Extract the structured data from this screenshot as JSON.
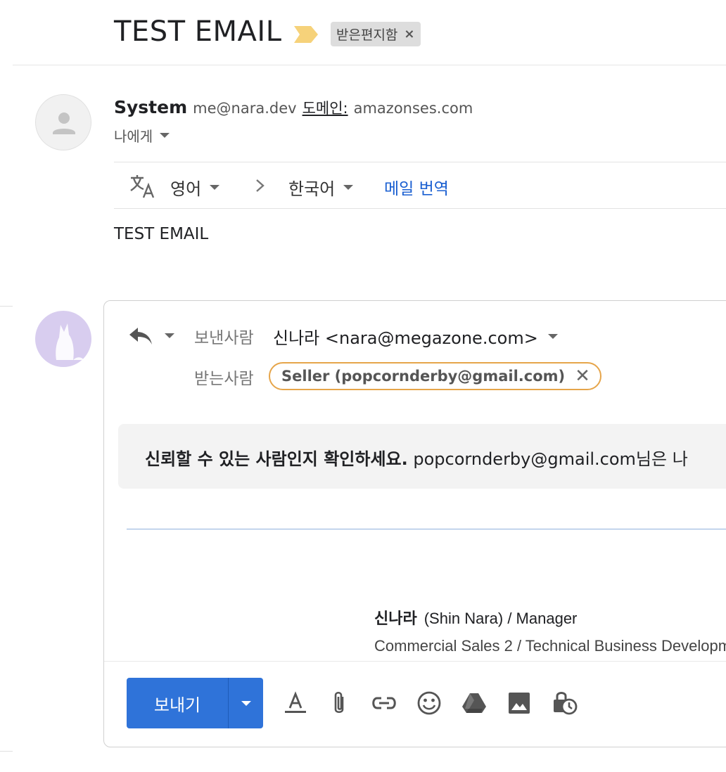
{
  "thread": {
    "subject": "TEST EMAIL",
    "label": "받은편지함",
    "label_remove": "×"
  },
  "message": {
    "sender_name": "System",
    "sender_email": "me@nara.dev",
    "domain_label": "도메인:",
    "domain_value": "amazonses.com",
    "to_me": "나에게",
    "body": "TEST EMAIL"
  },
  "translate": {
    "from_lang": "영어",
    "to_lang": "한국어",
    "action": "메일 번역"
  },
  "reply": {
    "from_label": "보낸사람",
    "from_value": "신나라 <nara@megazone.com>",
    "to_label": "받는사람",
    "recipient": "Seller (popcornderby@gmail.com)",
    "recipient_remove": "✕",
    "warning_bold": "신뢰할 수 있는 사람인지 확인하세요.",
    "warning_text": " popcornderby@gmail.com님은 나"
  },
  "signature": {
    "name_kr": "신나라",
    "name_en_title": "(Shin Nara) / Manager",
    "department": "Commercial Sales 2 / Technical Business Developm"
  },
  "toolbar": {
    "send_label": "보내기",
    "icons": [
      "format-text-icon",
      "attach-icon",
      "link-icon",
      "emoji-icon",
      "drive-icon",
      "photo-icon",
      "confidential-icon"
    ]
  },
  "colors": {
    "send_button": "#2f73d9",
    "translate_link": "#1a5fd1",
    "recipient_chip_border": "#e6a54a",
    "importance_marker": "#f6d27a"
  }
}
